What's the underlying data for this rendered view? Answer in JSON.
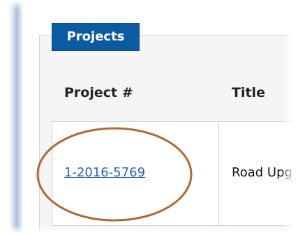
{
  "tab": {
    "label": "Projects"
  },
  "table": {
    "headers": {
      "project": "Project #",
      "title": "Title"
    },
    "rows": [
      {
        "project_number": "1-2016-5769",
        "title": "Road Upg"
      }
    ]
  },
  "colors": {
    "tab_bg": "#0b5aa2",
    "link": "#2a63b8",
    "highlight": "#b06a32"
  }
}
